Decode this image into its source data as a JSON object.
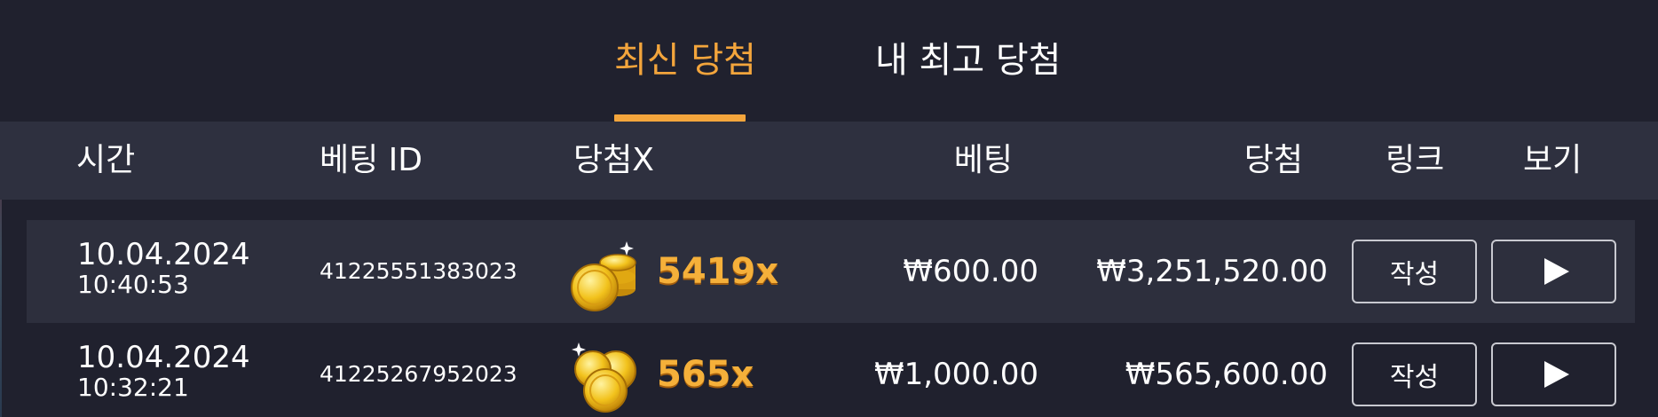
{
  "tabs": [
    {
      "label": "최신 당첨",
      "active": true
    },
    {
      "label": "내 최고 당첨",
      "active": false
    }
  ],
  "columns": {
    "time": "시간",
    "bet_id": "베팅 ID",
    "multiplier": "당첨X",
    "bet": "베팅",
    "win": "당첨",
    "link": "링크",
    "view": "보기"
  },
  "rows": [
    {
      "date": "10.04.2024",
      "time": "10:40:53",
      "bet_id": "41225551383023",
      "multiplier": "5419x",
      "bet": "₩600.00",
      "win": "₩3,251,520.00",
      "link_label": "작성",
      "coin_icon": "coin-stack-icon"
    },
    {
      "date": "10.04.2024",
      "time": "10:32:21",
      "bet_id": "41225267952023",
      "multiplier": "565x",
      "bet": "₩1,000.00",
      "win": "₩565,600.00",
      "link_label": "작성",
      "coin_icon": "coins-icon"
    }
  ],
  "colors": {
    "accent": "#f3a53c",
    "background": "#20212e",
    "header_bg": "#2e303f",
    "row_alt_bg": "#2d2f3d"
  }
}
